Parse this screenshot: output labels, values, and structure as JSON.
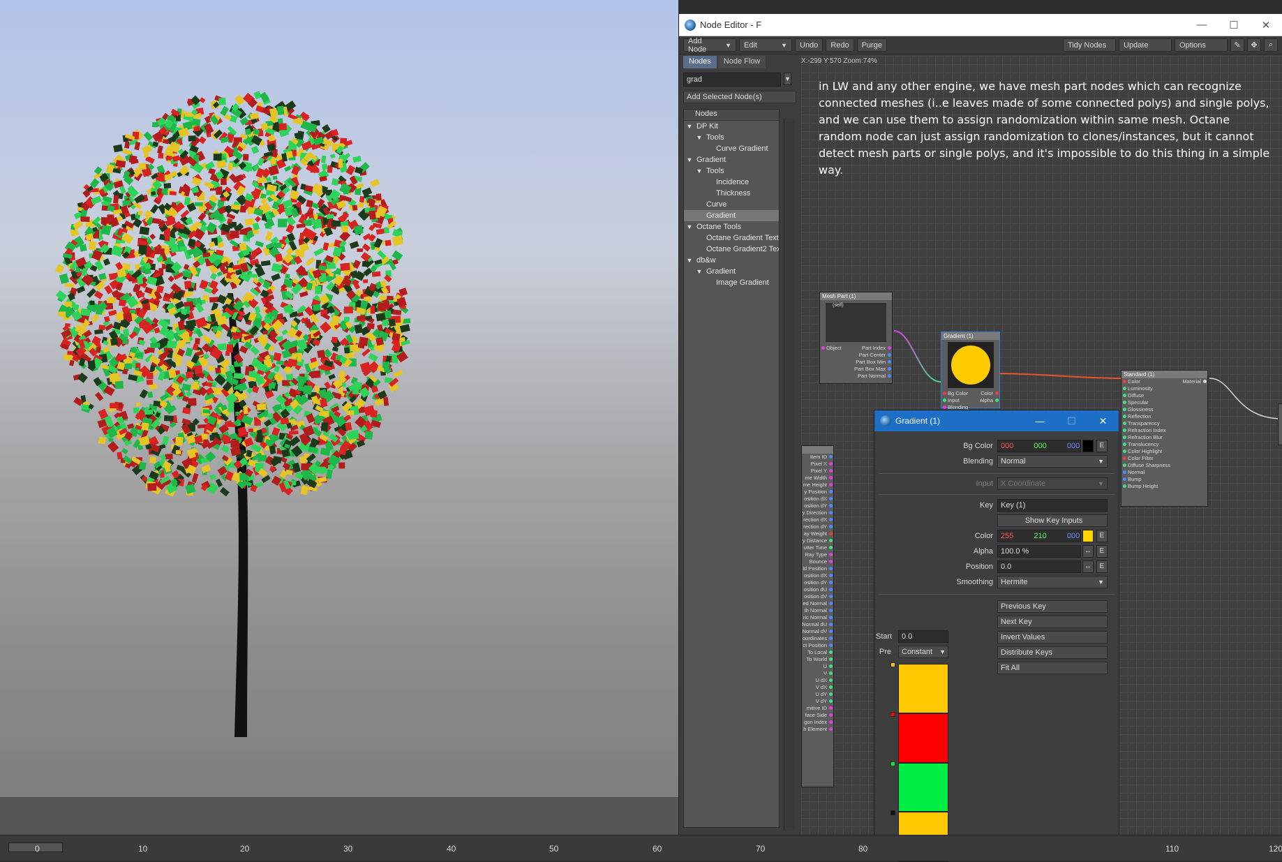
{
  "node_editor": {
    "title": "Node Editor - F",
    "toolbar": {
      "add_node": "Add Node",
      "edit": "Edit",
      "undo": "Undo",
      "redo": "Redo",
      "purge": "Purge",
      "tidy_nodes": "Tidy Nodes",
      "update": "Update",
      "options": "Options"
    },
    "tabs": [
      "Nodes",
      "Node Flow"
    ],
    "search_value": "grad",
    "add_selected": "Add Selected Node(s)",
    "tree_header": "Nodes",
    "tree_items": [
      {
        "label": "DP Kit",
        "indent": 0,
        "toggle": "▼"
      },
      {
        "label": "Tools",
        "indent": 1,
        "toggle": "▼"
      },
      {
        "label": "Curve Gradient",
        "indent": 2,
        "toggle": ""
      },
      {
        "label": "Gradient",
        "indent": 0,
        "toggle": "▼"
      },
      {
        "label": "Tools",
        "indent": 1,
        "toggle": "▼"
      },
      {
        "label": "Incidence",
        "indent": 2,
        "toggle": ""
      },
      {
        "label": "Thickness",
        "indent": 2,
        "toggle": ""
      },
      {
        "label": "Curve",
        "indent": 1,
        "toggle": ""
      },
      {
        "label": "Gradient",
        "indent": 1,
        "toggle": "",
        "selected": true
      },
      {
        "label": "Octane Tools",
        "indent": 0,
        "toggle": "▼"
      },
      {
        "label": "Octane Gradient Textu",
        "indent": 1,
        "toggle": ""
      },
      {
        "label": "Octane Gradient2 Tex",
        "indent": 1,
        "toggle": ""
      },
      {
        "label": "db&w",
        "indent": 0,
        "toggle": "▼"
      },
      {
        "label": "Gradient",
        "indent": 1,
        "toggle": "▼"
      },
      {
        "label": "Image Gradient",
        "indent": 2,
        "toggle": ""
      }
    ],
    "canvas": {
      "coords": "X:-299 Y:570 Zoom:74%",
      "note": "in LW and any other engine, we have mesh part nodes which can recognize connected meshes (i..e leaves made of some connected polys) and single polys, and we can use them to assign randomization within same mesh. Octane random node can just assign randomization to clones/instances, but it cannot detect mesh parts or single polys, and it's impossible to do this thing in a simple way."
    },
    "nodes": {
      "mesh_part": {
        "title": "Mesh Part (1)",
        "self": "(self)",
        "inputs": [
          "Object"
        ],
        "outputs": [
          "Part Index",
          "Part Center",
          "Part Box Min",
          "Part Box Max",
          "Part Normal"
        ]
      },
      "gradient": {
        "title": "Gradient (1)",
        "inputs": [
          "Bg Color",
          "Input",
          "Blending"
        ],
        "outputs": [
          "Color",
          "Alpha"
        ]
      },
      "standard": {
        "title": "Standard (1)",
        "output": "Material",
        "inputs": [
          "Color",
          "Luminosity",
          "Diffuse",
          "Specular",
          "Glossiness",
          "Reflection",
          "Transparency",
          "Refraction Index",
          "Refraction Blur",
          "Translucency",
          "Color Highlight",
          "Color Filter",
          "Diffuse Sharpness",
          "Normal",
          "Bump",
          "Bump Height"
        ]
      },
      "spot_info": {
        "outputs": [
          "Item ID",
          "Pixel X",
          "Pixel Y",
          "me Width",
          "me Height",
          "y Position",
          "osition dX",
          "osition dY",
          "y Direction",
          "rection dX",
          "rection dY",
          "ay Weight",
          "y Distance",
          "utter Time",
          "Ray Type",
          "Bounce",
          "ld Position",
          "osition dX",
          "osition dY",
          "osition dU",
          "osition dV",
          "ed Normal",
          "th Normal",
          "ric Normal",
          "Normal dU",
          "Normal dV",
          "oordinates",
          "ct Position",
          "To Local",
          "To World",
          "U",
          "V",
          "U dX",
          "V dX",
          "U dY",
          "V dY",
          "mitive ID",
          "face Side",
          "gon Index",
          "h Element"
        ]
      }
    }
  },
  "gradient_dialog": {
    "title": "Gradient (1)",
    "bg_color_label": "Bg Color",
    "bg_color": {
      "r": "000",
      "g": "000",
      "b": "000"
    },
    "blending_label": "Blending",
    "blending_value": "Normal",
    "input_label": "Input",
    "input_value": "X Coordinate",
    "key_label": "Key",
    "key_value": "Key (1)",
    "show_key_inputs": "Show Key Inputs",
    "color_label": "Color",
    "color": {
      "r": "255",
      "g": "210",
      "b": "000"
    },
    "alpha_label": "Alpha",
    "alpha_value": "100.0 %",
    "position_label": "Position",
    "position_value": "0.0",
    "smoothing_label": "Smoothing",
    "smoothing_value": "Hermite",
    "previous_key": "Previous Key",
    "next_key": "Next Key",
    "invert_values": "Invert Values",
    "distribute_keys": "Distribute Keys",
    "fit_all": "Fit All",
    "start_label": "Start",
    "start_value": "0.0",
    "pre_label": "Pre",
    "pre_value": "Constant",
    "e_label": "E",
    "gradient_keys": [
      {
        "color": "#ffc800"
      },
      {
        "color": "#ff0000"
      },
      {
        "color": "#00ee44"
      },
      {
        "color": "#ffc800"
      }
    ]
  },
  "timeline": {
    "ticks": [
      "0",
      "10",
      "20",
      "30",
      "40",
      "50",
      "60",
      "70",
      "80",
      "110",
      "120"
    ]
  },
  "colors": {
    "accent": "#1c6fc4",
    "key_yellow": "#ffd200",
    "red": "#ff0000",
    "green": "#00ee44"
  }
}
